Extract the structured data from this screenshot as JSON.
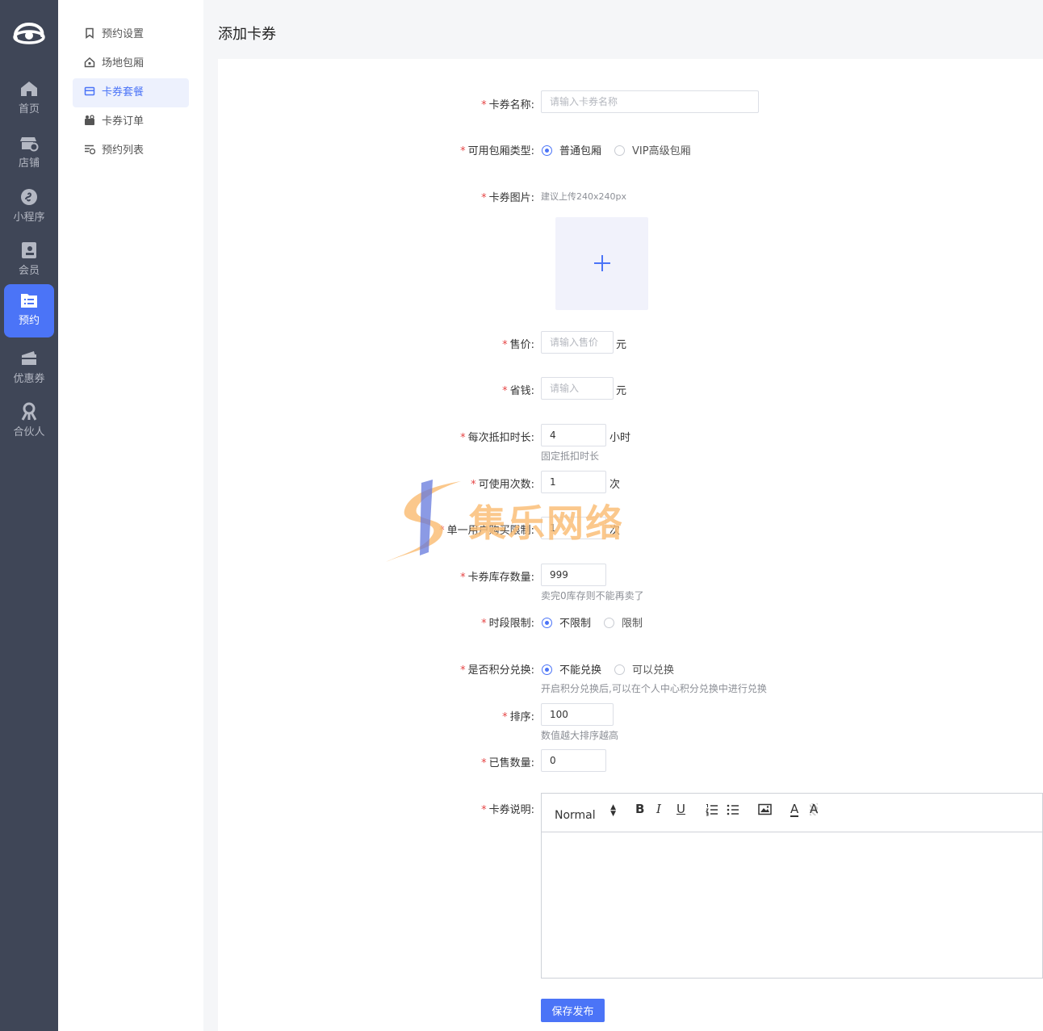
{
  "rail": {
    "items": [
      {
        "label": "首页",
        "icon": "home-icon"
      },
      {
        "label": "店铺",
        "icon": "store-icon"
      },
      {
        "label": "小程序",
        "icon": "mini-program-icon"
      },
      {
        "label": "会员",
        "icon": "member-icon"
      },
      {
        "label": "预约",
        "icon": "booking-icon",
        "active": true
      },
      {
        "label": "优惠券",
        "icon": "coupon-icon"
      },
      {
        "label": "合伙人",
        "icon": "partner-icon"
      }
    ]
  },
  "submenu": {
    "items": [
      {
        "label": "预约设置",
        "icon": "bookmark-icon"
      },
      {
        "label": "场地包厢",
        "icon": "house-icon"
      },
      {
        "label": "卡券套餐",
        "icon": "card-icon",
        "active": true
      },
      {
        "label": "卡券订单",
        "icon": "order-icon"
      },
      {
        "label": "预约列表",
        "icon": "list-icon"
      }
    ]
  },
  "page": {
    "title": "添加卡券"
  },
  "form": {
    "name": {
      "label": "卡券名称:",
      "placeholder": "请输入卡券名称",
      "value": ""
    },
    "room_type": {
      "label": "可用包厢类型:",
      "options": [
        "普通包厢",
        "VIP高级包厢"
      ],
      "selected": "普通包厢"
    },
    "image": {
      "label": "卡券图片:",
      "hint": "建议上传240x240px"
    },
    "price": {
      "label": "售价:",
      "placeholder": "请输入售价",
      "unit": "元"
    },
    "saving": {
      "label": "省钱:",
      "placeholder": "请输入",
      "unit": "元"
    },
    "duration": {
      "label": "每次抵扣时长:",
      "value": "4",
      "unit": "小时",
      "hint": "固定抵扣时长"
    },
    "uses": {
      "label": "可使用次数:",
      "value": "1",
      "unit": "次"
    },
    "per_user_limit": {
      "label": "单一用户购买限制:",
      "value": "1",
      "unit": "次"
    },
    "stock": {
      "label": "卡券库存数量:",
      "value": "999",
      "hint": "卖完0库存则不能再卖了"
    },
    "time_limit": {
      "label": "时段限制:",
      "options": [
        "不限制",
        "限制"
      ],
      "selected": "不限制"
    },
    "points": {
      "label": "是否积分兑换:",
      "options": [
        "不能兑换",
        "可以兑换"
      ],
      "selected": "不能兑换",
      "hint": "开启积分兑换后,可以在个人中心积分兑换中进行兑换"
    },
    "sort": {
      "label": "排序:",
      "value": "100",
      "hint": "数值越大排序越高"
    },
    "sold": {
      "label": "已售数量:",
      "value": "0"
    },
    "description": {
      "label": "卡券说明:",
      "format": "Normal"
    },
    "submit_label": "保存发布"
  },
  "watermark": {
    "text": "集乐网络"
  },
  "colors": {
    "accent": "#4b74f7",
    "rail_bg": "#3f4657",
    "required": "#e64545"
  }
}
